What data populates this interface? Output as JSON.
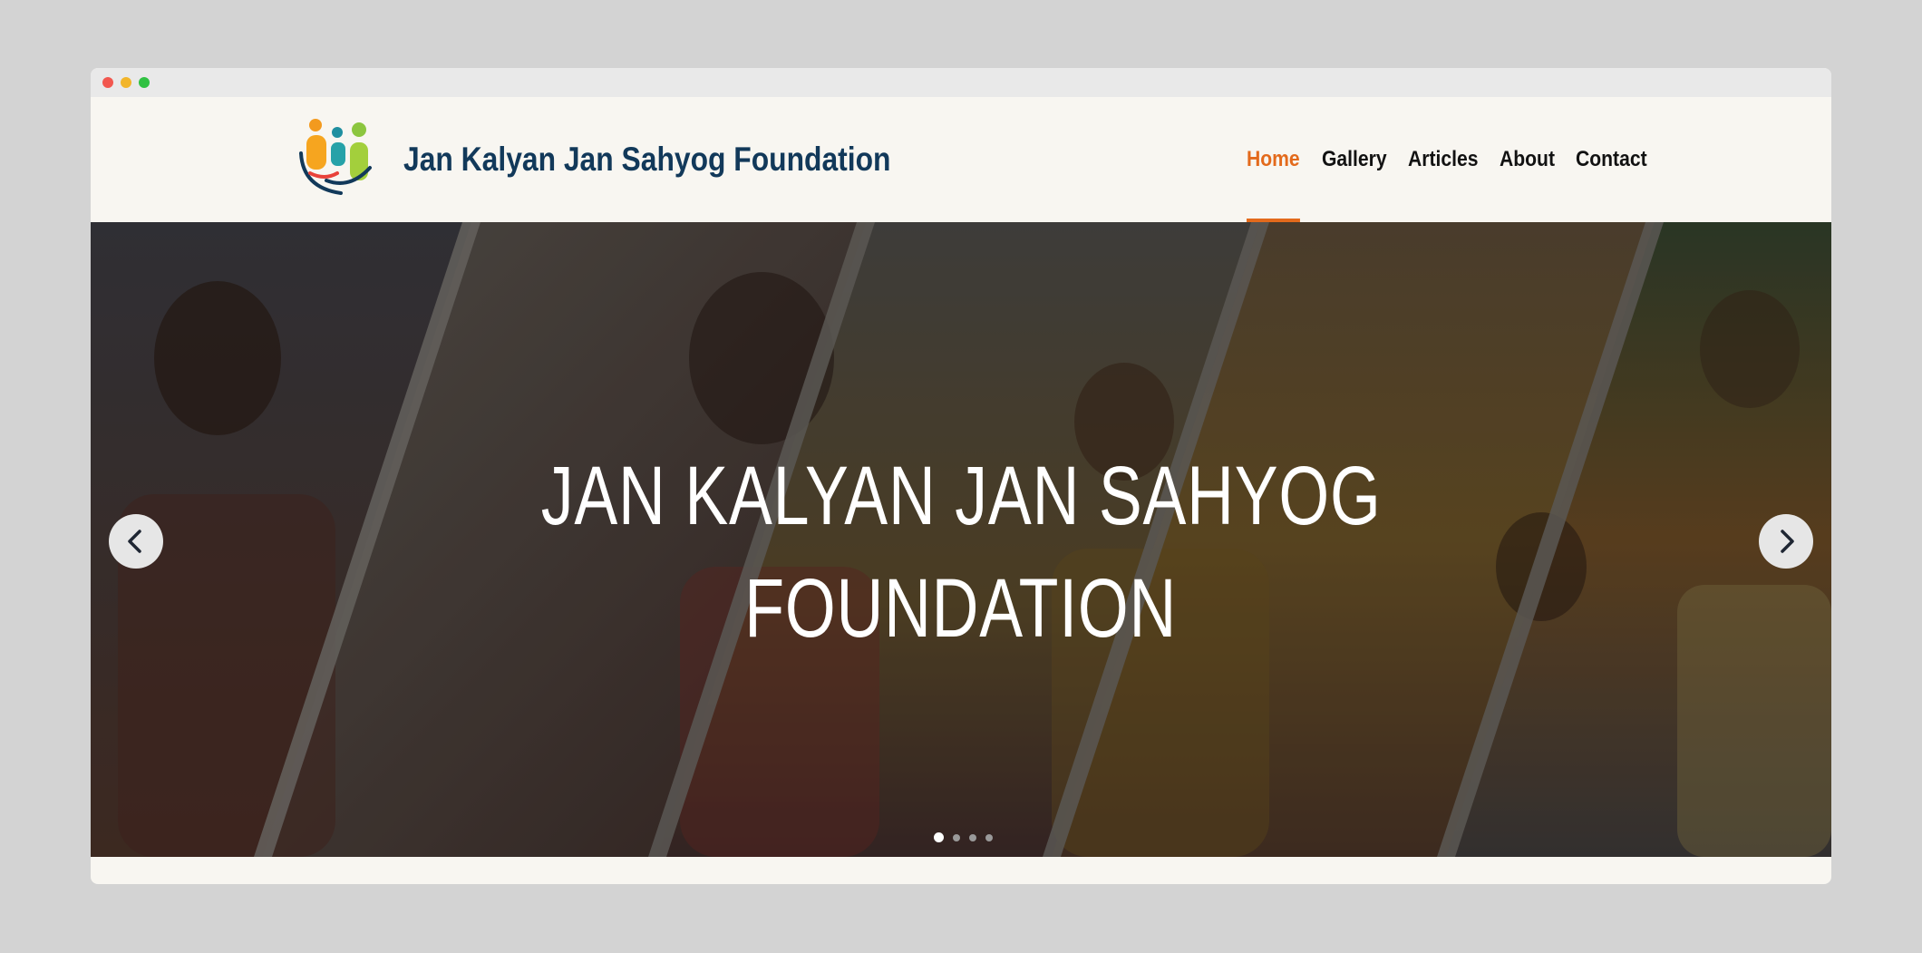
{
  "site": {
    "brand_name": "Jan Kalyan Jan Sahyog Foundation",
    "logo_icon": "family-logo-icon"
  },
  "nav": {
    "items": [
      {
        "label": "Home",
        "active": true
      },
      {
        "label": "Gallery",
        "active": false
      },
      {
        "label": "Articles",
        "active": false
      },
      {
        "label": "About",
        "active": false
      },
      {
        "label": "Contact",
        "active": false
      }
    ]
  },
  "hero": {
    "title_line1": "JAN KALYAN JAN SAHYOG",
    "title_line2": "FOUNDATION",
    "prev_icon": "chevron-left-icon",
    "next_icon": "chevron-right-icon",
    "slides_count": 4,
    "active_slide": 1
  },
  "colors": {
    "accent": "#e36a1c",
    "brand_text": "#12395a",
    "background": "#f8f6f1"
  }
}
